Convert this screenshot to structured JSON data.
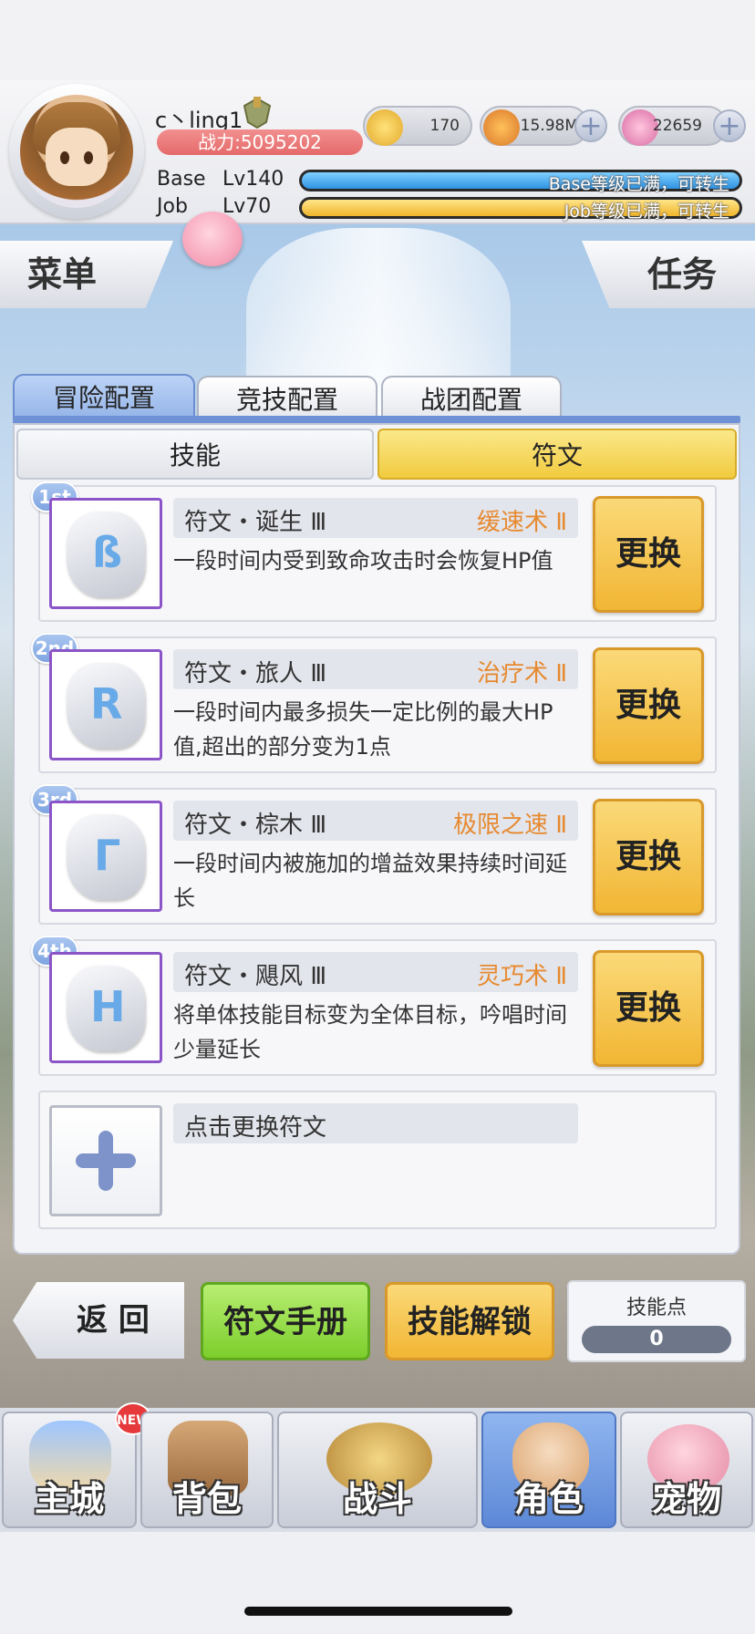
{
  "player": {
    "name": "c丶ling1",
    "power": "战力:5095202",
    "base_label": "Base",
    "base_level": "Lv140",
    "base_bar_text": "Base等级已满，可转生",
    "job_label": "Job",
    "job_level": "Lv70",
    "job_bar_text": "Job等级已满，可转生",
    "base_progress": 1.0,
    "job_progress": 1.0
  },
  "currencies": [
    {
      "icon": "zeny-coin-icon",
      "value": "170"
    },
    {
      "icon": "gold-coin-icon",
      "value": "15.98M"
    },
    {
      "icon": "pink-gem-icon",
      "value": "22659"
    }
  ],
  "side": {
    "menu": "菜单",
    "quest": "任务"
  },
  "tabs": [
    "冒险配置",
    "竞技配置",
    "战团配置"
  ],
  "segments": {
    "skill": "技能",
    "rune": "符文"
  },
  "runes": [
    {
      "rank": "1st",
      "glyph": "ß",
      "name": "符文・诞生 Ⅲ",
      "skill": "缓速术 Ⅱ",
      "desc": "一段时间内受到致命攻击时会恢复HP值",
      "button": "更换"
    },
    {
      "rank": "2nd",
      "glyph": "R",
      "name": "符文・旅人 Ⅲ",
      "skill": "治疗术 Ⅱ",
      "desc": "一段时间内最多损失一定比例的最大HP值,超出的部分变为1点",
      "button": "更换"
    },
    {
      "rank": "3rd",
      "glyph": "Γ",
      "name": "符文・棕木 Ⅲ",
      "skill": "极限之速 Ⅱ",
      "desc": "一段时间内被施加的增益效果持续时间延长",
      "button": "更换"
    },
    {
      "rank": "4th",
      "glyph": "H",
      "name": "符文・飓风 Ⅲ",
      "skill": "灵巧术 Ⅱ",
      "desc": "将单体技能目标变为全体目标，吟唱时间少量延长",
      "button": "更换"
    }
  ],
  "empty_slot": {
    "text": "点击更换符文"
  },
  "actions": {
    "back": "返 回",
    "manual": "符文手册",
    "unlock": "技能解锁",
    "skill_points_label": "技能点",
    "skill_points_value": "0"
  },
  "nav": [
    {
      "label": "主城",
      "badge": "NEW"
    },
    {
      "label": "背包"
    },
    {
      "label": "战斗"
    },
    {
      "label": "角色"
    },
    {
      "label": "宠物"
    }
  ],
  "colors": {
    "accent_blue": "#6f91d6",
    "swap_gold": "#f1b634",
    "skill_orange": "#e68a30",
    "rune_frame_purple": "#8b55c8"
  }
}
